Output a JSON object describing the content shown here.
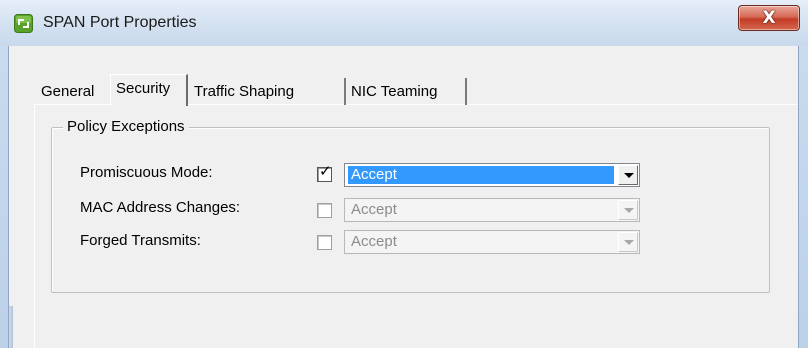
{
  "window": {
    "title": "SPAN Port Properties",
    "icon": "vsphere-app-icon",
    "close_label": "X"
  },
  "tabs": [
    {
      "label": "General",
      "active": false
    },
    {
      "label": "Security",
      "active": true
    },
    {
      "label": "Traffic Shaping",
      "active": false
    },
    {
      "label": "NIC Teaming",
      "active": false
    }
  ],
  "policy_group": {
    "label": "Policy Exceptions",
    "rows": [
      {
        "label": "Promiscuous Mode:",
        "checked": true,
        "value": "Accept",
        "enabled": true
      },
      {
        "label": "MAC Address Changes:",
        "checked": false,
        "value": "Accept",
        "enabled": false
      },
      {
        "label": "Forged Transmits:",
        "checked": false,
        "value": "Accept",
        "enabled": false
      }
    ]
  },
  "colors": {
    "selection": "#3399ff",
    "close_button": "#c43c26",
    "dialog_bg": "#f0f0f0"
  }
}
